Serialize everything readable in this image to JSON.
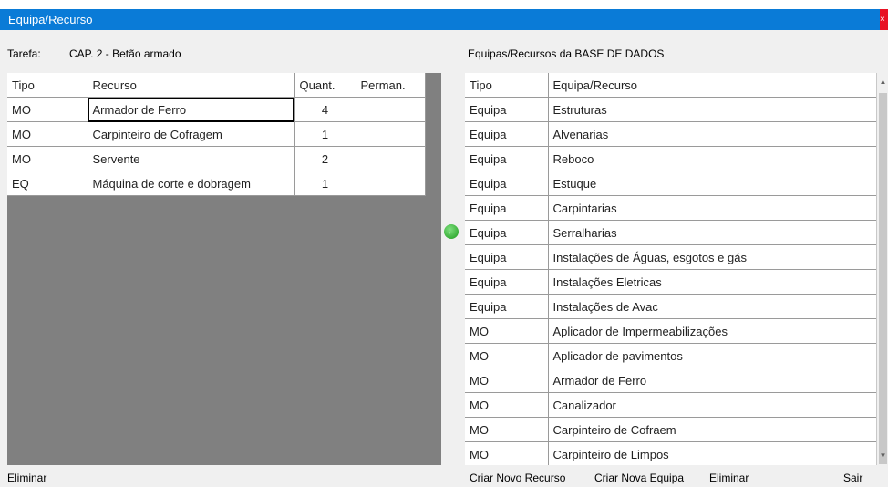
{
  "window": {
    "title": "Equipa/Recurso",
    "close_glyph": "×"
  },
  "task": {
    "label": "Tarefa:",
    "value": "CAP. 2 - Betão armado"
  },
  "left_table": {
    "headers": [
      "Tipo",
      "Recurso",
      "Quant.",
      "Perman."
    ],
    "rows": [
      [
        "MO",
        "Armador de Ferro",
        "4",
        ""
      ],
      [
        "MO",
        "Carpinteiro de Cofragem",
        "1",
        ""
      ],
      [
        "MO",
        "Servente",
        "2",
        ""
      ],
      [
        "EQ",
        "Máquina de corte e dobragem",
        "1",
        ""
      ]
    ]
  },
  "db_title": "Equipas/Recursos da BASE DE DADOS",
  "right_table": {
    "headers": [
      "Tipo",
      "Equipa/Recurso"
    ],
    "rows": [
      [
        "Equipa",
        "Estruturas"
      ],
      [
        "Equipa",
        "Alvenarias"
      ],
      [
        "Equipa",
        "Reboco"
      ],
      [
        "Equipa",
        "Estuque"
      ],
      [
        "Equipa",
        "Carpintarias"
      ],
      [
        "Equipa",
        "Serralharias"
      ],
      [
        "Equipa",
        "Instalações de Águas, esgotos e gás"
      ],
      [
        "Equipa",
        "Instalações Eletricas"
      ],
      [
        "Equipa",
        "Instalações de Avac"
      ],
      [
        "MO",
        "Aplicador de Impermeabilizações"
      ],
      [
        "MO",
        "Aplicador de pavimentos"
      ],
      [
        "MO",
        "Armador de Ferro"
      ],
      [
        "MO",
        "Canalizador"
      ],
      [
        "MO",
        "Carpinteiro de Cofraem"
      ],
      [
        "MO",
        "Carpinteiro de Limpos"
      ]
    ]
  },
  "current_row_icon": "green-left-arrow-icon",
  "buttons": {
    "eliminar_left": "Eliminar",
    "criar_recurso": "Criar Novo Recurso",
    "criar_equipa": "Criar Nova Equipa",
    "eliminar_right": "Eliminar",
    "sair": "Sair"
  },
  "colors": {
    "titlebar": "#0a7bd7",
    "grid_background": "#808080",
    "close_button": "#e81123"
  }
}
